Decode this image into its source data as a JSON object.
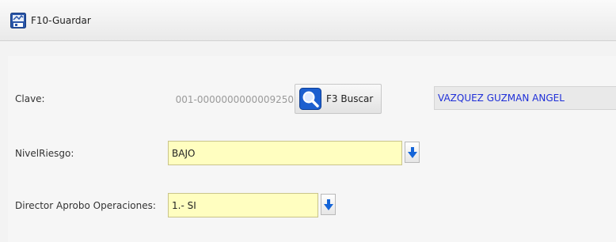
{
  "toolbar": {
    "save_label": "F10-Guardar",
    "save_icon": "save-icon"
  },
  "form": {
    "clave": {
      "label": "Clave:",
      "value": "001-0000000000009250",
      "search_label": "F3 Buscar",
      "search_icon": "magnifier-icon",
      "name_value": "VAZQUEZ GUZMAN ANGEL"
    },
    "nivel_riesgo": {
      "label": "NivelRiesgo:",
      "value": "BAJO",
      "dropdown_icon": "arrow-down-icon"
    },
    "director": {
      "label": "Director Aprobo Operaciones:",
      "value": "1.- SI",
      "dropdown_icon": "arrow-down-icon"
    }
  },
  "colors": {
    "input_background": "#fffec0",
    "name_text": "#1f2fd8",
    "toolbar_background": "#eeeeee",
    "accent_blue": "#1565d8"
  }
}
